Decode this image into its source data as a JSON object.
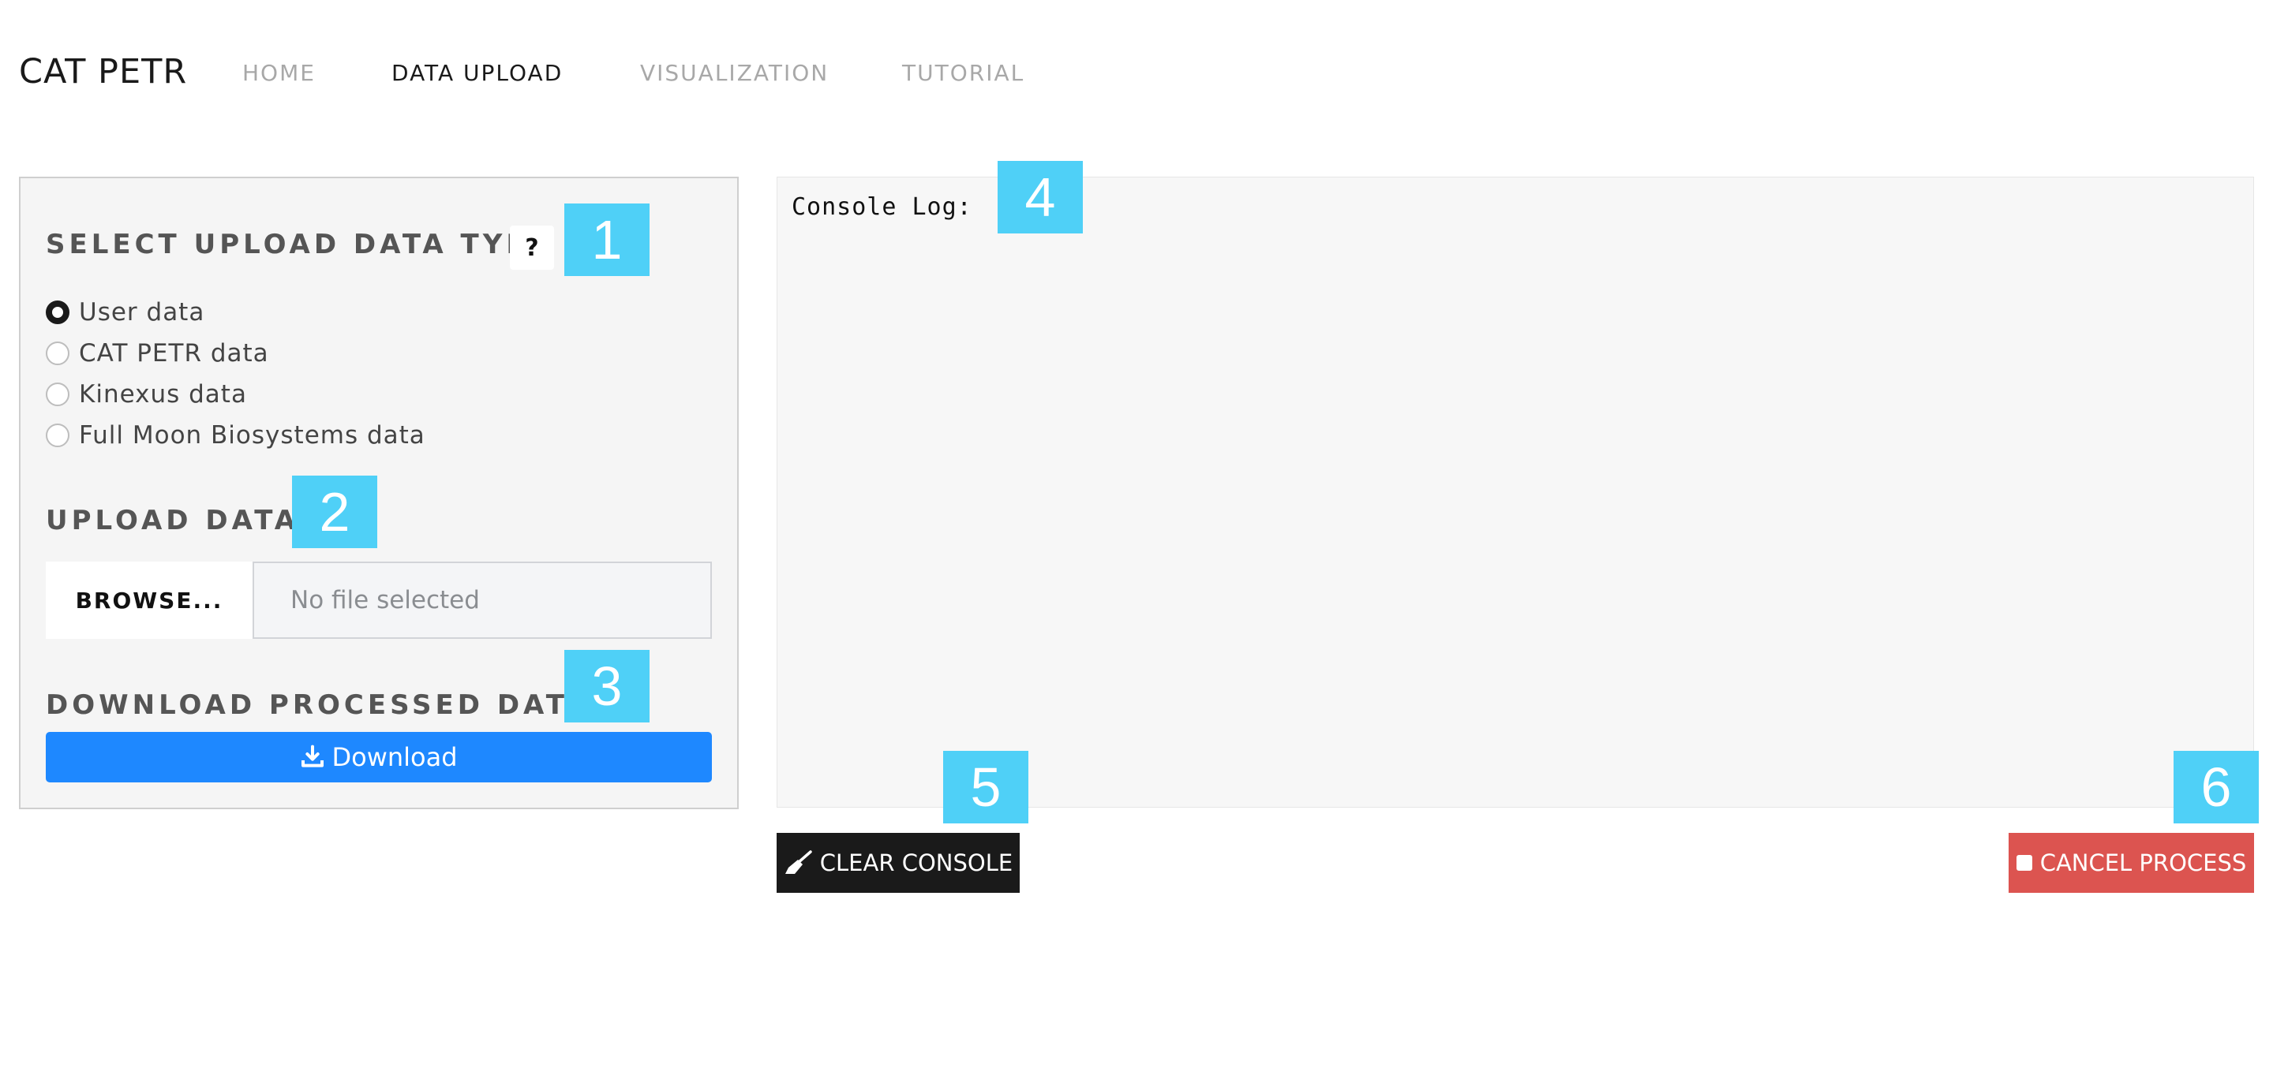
{
  "navbar": {
    "brand": "CAT PETR",
    "links": [
      "HOME",
      "DATA UPLOAD",
      "VISUALIZATION",
      "TUTORIAL"
    ],
    "active": "DATA UPLOAD"
  },
  "upload_panel": {
    "select_title": "SELECT UPLOAD DATA TYPE",
    "help_label": "?",
    "options": [
      "User data",
      "CAT PETR data",
      "Kinexus data",
      "Full Moon Biosystems data"
    ],
    "selected_option": "User data",
    "upload_title": "UPLOAD DATA",
    "browse_label": "BROWSE...",
    "file_placeholder": "No file selected",
    "download_title": "DOWNLOAD PROCESSED DATA",
    "download_label": "Download"
  },
  "console": {
    "label": "Console Log:",
    "clear_label": "CLEAR CONSOLE",
    "cancel_label": "CANCEL PROCESS"
  },
  "annotations": [
    "1",
    "2",
    "3",
    "4",
    "5",
    "6"
  ],
  "colors": {
    "download": "#1e88ff",
    "cancel": "#dc5450",
    "clear": "#1a1a1a",
    "badge": "#4fd0f7"
  }
}
